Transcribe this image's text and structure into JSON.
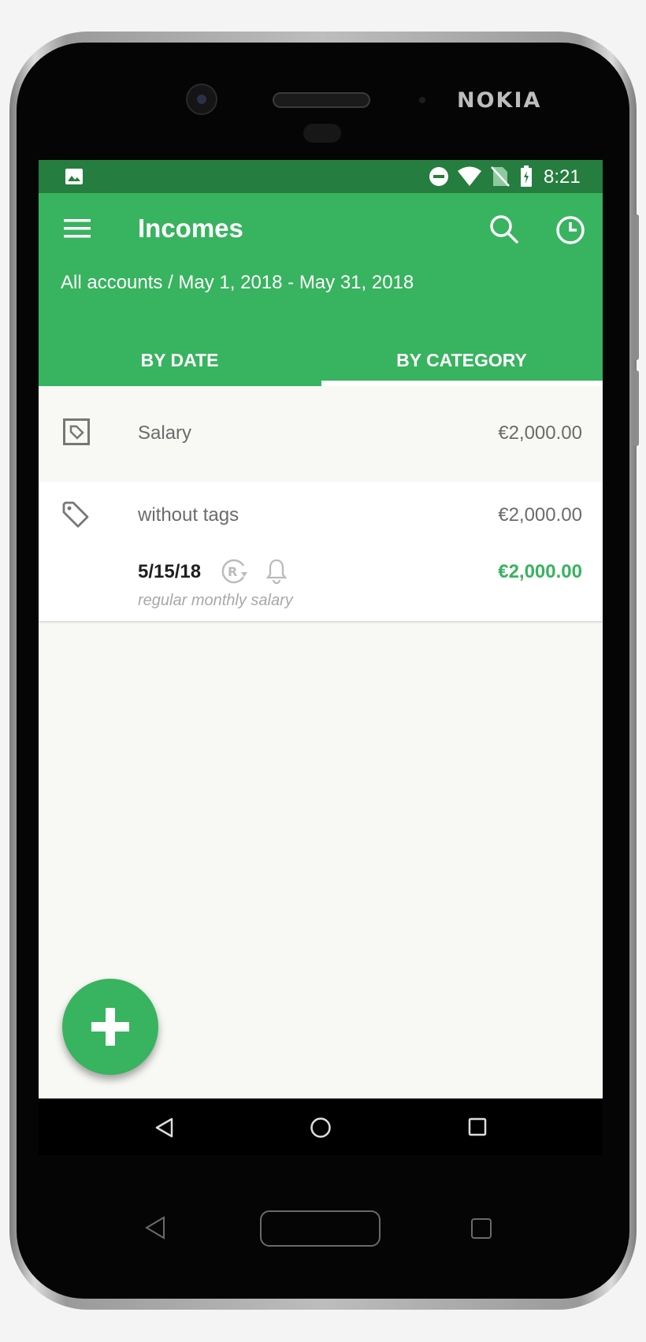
{
  "device": {
    "brand": "NOKIA"
  },
  "status_bar": {
    "time": "8:21"
  },
  "app_bar": {
    "title": "Incomes",
    "subtitle": "All accounts / May 1, 2018 - May 31, 2018",
    "tabs": [
      {
        "label": "BY DATE",
        "selected": false
      },
      {
        "label": "BY CATEGORY",
        "selected": true
      }
    ]
  },
  "category": {
    "name": "Salary",
    "total": "€2,000.00"
  },
  "group": {
    "tag_label": "without tags",
    "tag_total": "€2,000.00",
    "transactions": [
      {
        "date": "5/15/18",
        "amount": "€2,000.00",
        "note": "regular monthly salary"
      }
    ]
  },
  "colors": {
    "primary": "#38b35f",
    "primary_dark": "#257e3f",
    "income_amount": "#38b35f",
    "background": "#f8f8f4"
  },
  "icons": {
    "menu": "menu-icon",
    "search": "search-icon",
    "history": "history-icon",
    "category": "category-tag-icon",
    "tag": "tag-icon",
    "repeat": "repeat-icon",
    "reminder": "bell-icon",
    "add": "plus-icon"
  }
}
